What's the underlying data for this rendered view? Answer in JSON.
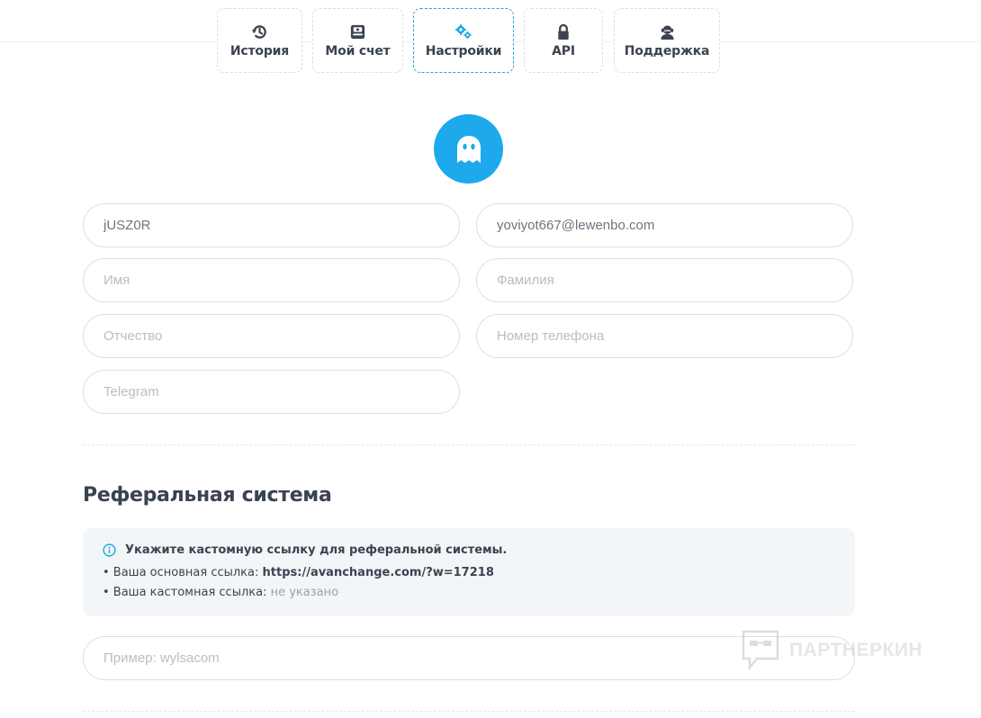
{
  "tabs": [
    {
      "label": "История",
      "icon": "history-icon"
    },
    {
      "label": "Мой счет",
      "icon": "wallet-icon"
    },
    {
      "label": "Настройки",
      "icon": "gears-icon",
      "active": true
    },
    {
      "label": "API",
      "icon": "lock-icon"
    },
    {
      "label": "Поддержка",
      "icon": "support-agent-icon"
    }
  ],
  "avatar": {
    "icon": "ghost-icon",
    "color": "#1da9ec"
  },
  "profile": {
    "login": {
      "value": "jUSZ0R",
      "placeholder": ""
    },
    "email": {
      "value": "yoviyot667@lewenbo.com",
      "placeholder": ""
    },
    "first_name": {
      "value": "",
      "placeholder": "Имя"
    },
    "last_name": {
      "value": "",
      "placeholder": "Фамилия"
    },
    "middle_name": {
      "value": "",
      "placeholder": "Отчество"
    },
    "phone": {
      "value": "",
      "placeholder": "Номер телефона"
    },
    "telegram": {
      "value": "",
      "placeholder": "Telegram"
    }
  },
  "referral": {
    "title": "Реферальная система",
    "info_title": "Укажите кастомную ссылку для реферальной системы.",
    "main_link_label": "• Ваша основная ссылка: ",
    "main_link_value": "https://avanchange.com/?w=17218",
    "custom_link_label": "• Ваша кастомная ссылка: ",
    "custom_link_value": "не указано",
    "input_placeholder": "Пример: wylsacom"
  },
  "watermark": {
    "text": "ПАРТНЕРКИН"
  },
  "colors": {
    "accent": "#1da9ec",
    "text": "#3b4350",
    "border": "#dcdfe4",
    "info_bg": "#f2f6f9"
  }
}
